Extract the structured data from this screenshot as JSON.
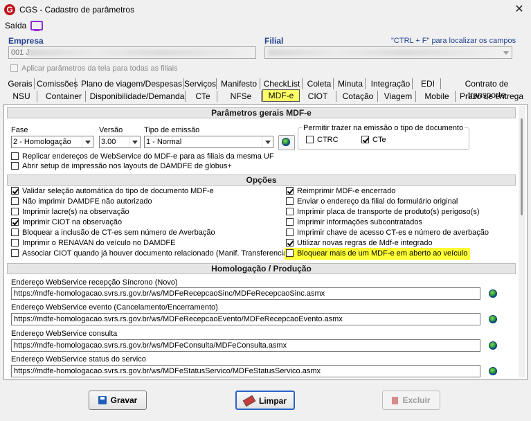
{
  "window": {
    "title": "CGS - Cadastro de parâmetros",
    "close_glyph": "✕"
  },
  "menu": {
    "saida": "Saída"
  },
  "empresa": {
    "label": "Empresa",
    "value": "001 J"
  },
  "filial": {
    "label": "Filial",
    "hint": "\"CTRL + F\" para localizar os campos"
  },
  "apply_all": "Aplicar parâmetros da tela para todas as filiais",
  "tabs_row1": [
    "Gerais",
    "Comissões",
    "Plano de viagem/Despesas",
    "Serviços",
    "Manifesto",
    "CheckList",
    "Coleta",
    "Minuta",
    "Integração",
    "EDI",
    "Contrato de transporte"
  ],
  "tabs_row2": [
    "NSU",
    "Container",
    "Disponibilidade/Demanda",
    "CTe",
    "NFSe",
    "MDF-e",
    "CIOT",
    "Cotação",
    "Viagem",
    "Mobile",
    "Prazo de entrega"
  ],
  "active_tab": "MDF-e",
  "gerais": {
    "header": "Parâmetros gerais MDF-e",
    "fase_label": "Fase",
    "fase_value": "2 - Homologação",
    "versao_label": "Versão",
    "versao_value": "3.00",
    "tipo_label": "Tipo de emissão",
    "tipo_value": "1 - Normal",
    "permitir_label": "Permitir trazer na emissão o tipo de documento",
    "ctrc_label": "CTRC",
    "cte_label": "CTe",
    "replicar": "Replicar endereços de WebService do MDF-e para as filiais da mesma UF",
    "abrir_setup": "Abrir setup de impressão nos layouts de DAMDFE de globus+"
  },
  "opcoes": {
    "header": "Opções",
    "left": [
      {
        "label": "Validar seleção automática do tipo de documento MDF-e",
        "checked": true
      },
      {
        "label": "Não imprimir DAMDFE não autorizado",
        "checked": false
      },
      {
        "label": "Imprimir lacre(s) na observação",
        "checked": false
      },
      {
        "label": "Imprimir CIOT na observação",
        "checked": true
      },
      {
        "label": "Bloquear a inclusão de CT-es sem número de Averbação",
        "checked": false
      },
      {
        "label": "Imprimir o RENAVAN do veículo no DAMDFE",
        "checked": false
      },
      {
        "label": "Associar CIOT quando já houver documento relacionado (Manif. Transferencia)",
        "checked": false
      }
    ],
    "right": [
      {
        "label": "Reimprimir MDF-e encerrado",
        "checked": true
      },
      {
        "label": "Enviar o endereço da filial do formulário original",
        "checked": false
      },
      {
        "label": "Imprimir placa de transporte de produto(s) perigoso(s)",
        "checked": false
      },
      {
        "label": "Imprimir informações subcontratados",
        "checked": false
      },
      {
        "label": "Imprimir chave de acesso CT-es e número de averbação",
        "checked": false
      },
      {
        "label": "Utilizar novas regras de Mdf-e integrado",
        "checked": true
      },
      {
        "label": "Bloquear mais de um MDF-e em aberto ao veículo",
        "checked": false
      }
    ]
  },
  "homologacao": {
    "header": "Homologação / Produção",
    "endpoints": [
      {
        "label": "Endereço WebService recepção Síncrono (Novo)",
        "url": "https://mdfe-homologacao.svrs.rs.gov.br/ws/MDFeRecepcaoSinc/MDFeRecepcaoSinc.asmx"
      },
      {
        "label": "Endereço WebService evento (Cancelamento/Encerramento)",
        "url": "https://mdfe-homologacao.svrs.rs.gov.br/ws/MDFeRecepcaoEvento/MDFeRecepcaoEvento.asmx"
      },
      {
        "label": "Endereço WebService consulta",
        "url": "https://mdfe-homologacao.svrs.rs.gov.br/ws/MDFeConsulta/MDFeConsulta.asmx"
      },
      {
        "label": "Endereço WebService status do servico",
        "url": "https://mdfe-homologacao.svrs.rs.gov.br/ws/MDFeStatusServico/MDFeStatusServico.asmx"
      }
    ]
  },
  "buttons": {
    "gravar": "Gravar",
    "limpar": "Limpar",
    "excluir": "Excluir"
  },
  "colors": {
    "highlight": "#ffff33",
    "label_blue": "#1f3f8f",
    "primary_border": "#2b62c6"
  }
}
